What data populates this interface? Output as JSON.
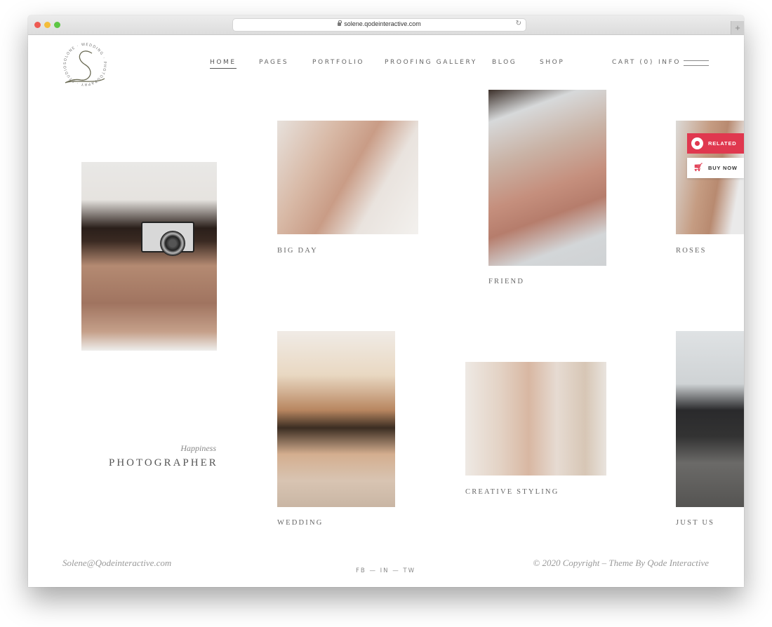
{
  "browser": {
    "url": "solene.qodeinteractive.com",
    "new_tab_label": "+",
    "reload_icon": "↻"
  },
  "logo": {
    "ring_text": "SOLONE · WEDDING · PHOTOGRAPHY · STUDIO",
    "letter": "S"
  },
  "nav": {
    "items": [
      {
        "label": "HOME",
        "active": true
      },
      {
        "label": "PAGES"
      },
      {
        "label": "PORTFOLIO"
      },
      {
        "label": "PROOFING GALLERY"
      },
      {
        "label": "BLOG"
      },
      {
        "label": "SHOP"
      }
    ],
    "cart": "CART (0)",
    "info": "INFO"
  },
  "hero": {
    "subtitle": "Happiness",
    "title": "PHOTOGRAPHER"
  },
  "gallery": [
    {
      "caption": "BIG DAY",
      "image": "bride-hands-on-chest"
    },
    {
      "caption": "FRIEND",
      "image": "hands-with-rings"
    },
    {
      "caption": "ROSES",
      "image": "bride-with-roses"
    },
    {
      "caption": "WEDDING",
      "image": "couple-laughing-beach"
    },
    {
      "caption": "CREATIVE STYLING",
      "image": "lace-dress-back"
    },
    {
      "caption": "JUST US",
      "image": "couple-walking-beach"
    }
  ],
  "side_widgets": {
    "related": "RELATED",
    "buy_now": "BUY NOW",
    "accent_color": "#e0384f"
  },
  "footer": {
    "email": "Solene@Qodeinteractive.com",
    "social": [
      "FB",
      "IN",
      "TW"
    ],
    "separator": "—",
    "copyright": "© 2020 Copyright – Theme By Qode Interactive"
  }
}
